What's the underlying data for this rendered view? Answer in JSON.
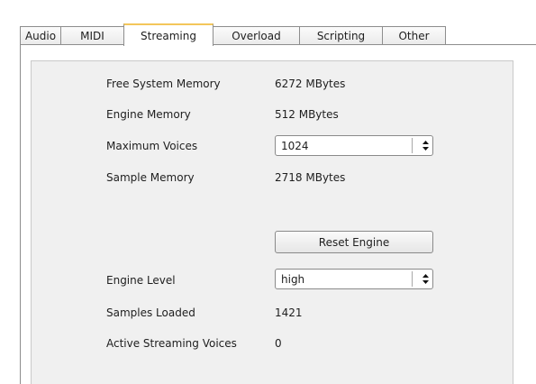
{
  "tabs": [
    {
      "label": "Audio",
      "active": false
    },
    {
      "label": "MIDI",
      "active": false
    },
    {
      "label": "Streaming",
      "active": true
    },
    {
      "label": "Overload",
      "active": false
    },
    {
      "label": "Scripting",
      "active": false
    },
    {
      "label": "Other",
      "active": false
    }
  ],
  "streaming": {
    "free_system_memory_label": "Free System Memory",
    "free_system_memory_value": "6272 MBytes",
    "engine_memory_label": "Engine Memory",
    "engine_memory_value": "512 MBytes",
    "maximum_voices_label": "Maximum Voices",
    "maximum_voices_value": "1024",
    "sample_memory_label": "Sample Memory",
    "sample_memory_value": "2718 MBytes",
    "reset_engine_label": "Reset Engine",
    "engine_level_label": "Engine Level",
    "engine_level_value": "high",
    "samples_loaded_label": "Samples Loaded",
    "samples_loaded_value": "1421",
    "active_streaming_voices_label": "Active Streaming Voices",
    "active_streaming_voices_value": "0"
  },
  "icons": {
    "select_arrows": "updown-arrows-icon"
  }
}
